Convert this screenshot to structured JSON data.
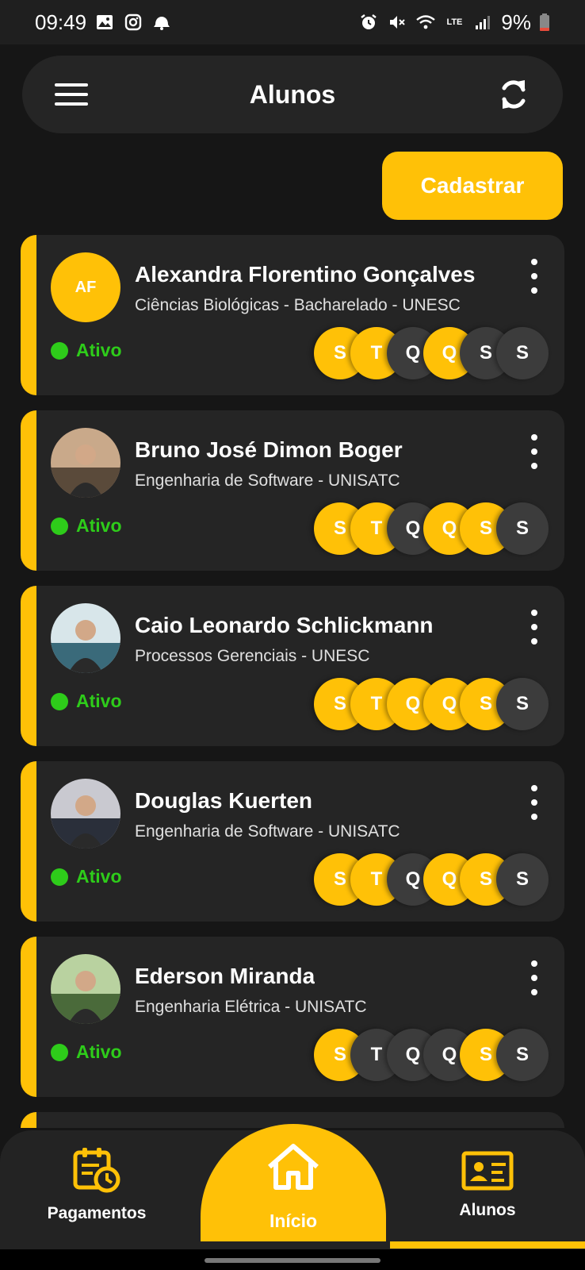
{
  "status_bar": {
    "time": "09:49",
    "battery": "9%",
    "network": "LTE",
    "icons": [
      "image-icon",
      "instagram-icon",
      "notification-icon",
      "alarm-icon",
      "mute-icon",
      "wifi-icon",
      "signal-icon",
      "battery-icon"
    ]
  },
  "header": {
    "title": "Alunos",
    "menu_icon": "menu-icon",
    "refresh_icon": "refresh-icon"
  },
  "actions": {
    "cadastrar_label": "Cadastrar"
  },
  "colors": {
    "accent": "#ffc107",
    "active_status": "#2ecc1a",
    "card": "#252525",
    "background": "#161616"
  },
  "students": [
    {
      "name": "Alexandra Florentino Gonçalves",
      "course": "Ciências Biológicas - Bacharelado - UNESC",
      "status": "Ativo",
      "initials": "AF",
      "avatar": "initials",
      "days": [
        {
          "letter": "S",
          "active": true
        },
        {
          "letter": "T",
          "active": true
        },
        {
          "letter": "Q",
          "active": false
        },
        {
          "letter": "Q",
          "active": true
        },
        {
          "letter": "S",
          "active": false
        },
        {
          "letter": "S",
          "active": false
        }
      ]
    },
    {
      "name": "Bruno José Dimon Boger",
      "course": "Engenharia de Software - UNISATC",
      "status": "Ativo",
      "initials": "",
      "avatar": "photo",
      "days": [
        {
          "letter": "S",
          "active": true
        },
        {
          "letter": "T",
          "active": true
        },
        {
          "letter": "Q",
          "active": false
        },
        {
          "letter": "Q",
          "active": true
        },
        {
          "letter": "S",
          "active": true
        },
        {
          "letter": "S",
          "active": false
        }
      ]
    },
    {
      "name": "Caio Leonardo Schlickmann",
      "course": "Processos Gerenciais - UNESC",
      "status": "Ativo",
      "initials": "",
      "avatar": "photo",
      "days": [
        {
          "letter": "S",
          "active": true
        },
        {
          "letter": "T",
          "active": true
        },
        {
          "letter": "Q",
          "active": true
        },
        {
          "letter": "Q",
          "active": true
        },
        {
          "letter": "S",
          "active": true
        },
        {
          "letter": "S",
          "active": false
        }
      ]
    },
    {
      "name": "Douglas Kuerten",
      "course": "Engenharia de Software - UNISATC",
      "status": "Ativo",
      "initials": "",
      "avatar": "photo",
      "days": [
        {
          "letter": "S",
          "active": true
        },
        {
          "letter": "T",
          "active": true
        },
        {
          "letter": "Q",
          "active": false
        },
        {
          "letter": "Q",
          "active": true
        },
        {
          "letter": "S",
          "active": true
        },
        {
          "letter": "S",
          "active": false
        }
      ]
    },
    {
      "name": "Ederson Miranda",
      "course": "Engenharia Elétrica - UNISATC",
      "status": "Ativo",
      "initials": "",
      "avatar": "photo",
      "days": [
        {
          "letter": "S",
          "active": true
        },
        {
          "letter": "T",
          "active": false
        },
        {
          "letter": "Q",
          "active": false
        },
        {
          "letter": "Q",
          "active": false
        },
        {
          "letter": "S",
          "active": true
        },
        {
          "letter": "S",
          "active": false
        }
      ]
    }
  ],
  "bottom_nav": {
    "pagamentos": {
      "label": "Pagamentos",
      "icon": "payment-calendar-icon"
    },
    "inicio": {
      "label": "Início",
      "icon": "home-icon"
    },
    "alunos": {
      "label": "Alunos",
      "icon": "id-card-icon",
      "active": true
    }
  }
}
